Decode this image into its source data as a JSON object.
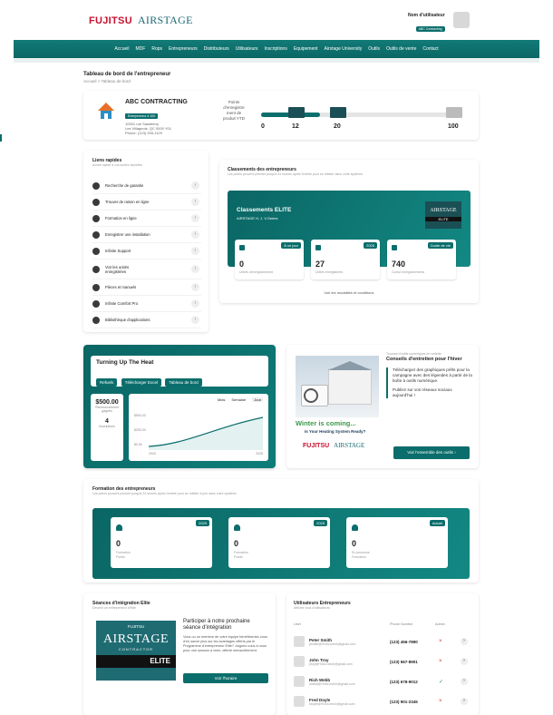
{
  "header": {
    "brand1": "FUJITSU",
    "brand2": "AIRSTAGE",
    "user_label": "Nom d'utilisateur",
    "user_badge": "ABC Contracting"
  },
  "nav": [
    "Accueil",
    "MDF",
    "Rops",
    "Entrepreneurs",
    "Distributeurs",
    "Utilisateurs",
    "Inscriptions",
    "Equipement",
    "Airstage University",
    "Outils",
    "Outils de vente",
    "Contact"
  ],
  "page": {
    "title": "Tableau de bord de l'entrepreneur",
    "breadcrumb": "Accueil > Tableau de bord"
  },
  "company": {
    "name": "ABC CONTRACTING",
    "badge": "Entrepreneur # 100",
    "addr1": "10001 rue Saskberry",
    "addr2": "Les Villageois, QC 0000 Y01",
    "phone": "Phone: (123) 255-1129"
  },
  "points": {
    "label1": "Points",
    "label2": "d'enregistre",
    "label3": "ment de",
    "label4": "produit YTD",
    "ticks": [
      "0",
      "12",
      "20",
      "100"
    ],
    "progress": 0.3
  },
  "quick": {
    "title": "Liens rapides",
    "subtitle": "Accès rapide à vos sorties favorites",
    "items": [
      "Recherche de garantie",
      "Trouver de raison en ligne",
      "Formation en ligne",
      "Enregistrer une installation",
      "Infinite Support",
      "Voir les unités\nenregistrées",
      "Pièces et manuels",
      "Infinite Comfort Pro",
      "Bibliothèque d'applications"
    ]
  },
  "rank": {
    "title": "Classements des entrepreneurs",
    "subtitle": "Les points peuvent prendre jusqu'à 24 heures après l'entrée pour se refléter dans votre système.",
    "elite_title": "Classements ELITE",
    "elite_sub": "AIRSTAGE H, J, V-Series",
    "logo": "AIRSTAGE",
    "logo_tag": "ELITE",
    "tiles": [
      {
        "badge": "À ce jour",
        "value": "0",
        "label": "Unités d'enregistrement"
      },
      {
        "badge": "2025",
        "value": "27",
        "label": "Unités enregistrées"
      },
      {
        "badge": "Guide de vie",
        "value": "740",
        "label": "Cumul enregistrements"
      }
    ],
    "link": "Voir les modalités et conditions"
  },
  "heat": {
    "title": "Turning Up The Heat",
    "b1": "Refuels",
    "b2": "Télécharger Excel",
    "b3": "Tableau de bord",
    "amount": "$500.00",
    "amount_label": "Remboursement gagnés",
    "count": "4",
    "count_label": "Inscriptions",
    "tabs": [
      "Mois",
      "Semaine",
      "Jour"
    ],
    "y": [
      "$500.00",
      "$250.00",
      "$0.00"
    ],
    "x": [
      "2025",
      "2025"
    ]
  },
  "winter": {
    "kicker": "Trousse d'outils numériques en vedette",
    "title": "Conseils d'entretien pour l'hiver",
    "p1": "Téléchargez des graphiques prêts pour la campagne avec des légendes à partir de la boîte à outils numérique.",
    "p2": "Publiez sur vos réseaux sociaux aujourd'hui !",
    "caption": "Winter is coming...",
    "caption2": "Is Your Heating System Ready?",
    "logo1": "FUJITSU",
    "logo2": "AIRSTAGE",
    "btn": "Voir l'ensemble des outils"
  },
  "training": {
    "title": "Formation des entrepreneurs",
    "subtitle": "Les points peuvent prendre jusqu'à 24 heures après l'entrée pour se refléter à jour dans votre système.",
    "tiles": [
      {
        "badge": "2025",
        "value": "0",
        "label": "Formation\nPoints"
      },
      {
        "badge": "2025",
        "value": "0",
        "label": "Formation\nPoints"
      },
      {
        "badge": "Actuel",
        "value": "0",
        "label": "En personne\nFormation"
      }
    ]
  },
  "integration": {
    "title": "Séances d'intégration Elite",
    "subtitle": "Devenir un entrepreneur d'élite",
    "logo_top": "FUJITSU",
    "logo": "AIRSTAGE",
    "logo_sub": "CONTRACTOR",
    "logo_tag": "ELITE",
    "heading": "Participer à notre prochaine séance d'intégration",
    "body": "Vous ou un membre de votre équipe bénéficieriez-vous d'en savoir plus sur les avantages offerts par le Programme d'entrepreneur Elite? Joignez-vous à nous pour une session à venir, offerte mensuellement.",
    "btn": "Voir l'horaire"
  },
  "users": {
    "title": "Utilisateurs Entrepreneurs",
    "subtitle": "Afficher tous d'utilisateurs",
    "cols": [
      "User",
      "Phone Number",
      "Admin"
    ],
    "rows": [
      {
        "name": "Peter Smith",
        "email": "psmith@HVACmech@gmail.com",
        "phone": "(123) 456-7890",
        "admin": "×"
      },
      {
        "name": "John Troy",
        "email": "jtroy@HVACmech@gmail.com",
        "phone": "(123) 567-8901",
        "admin": "×"
      },
      {
        "name": "Rich Webb",
        "email": "rwebb@HVACmech@gmail.com",
        "phone": "(123) 678-9012",
        "admin": "✓"
      },
      {
        "name": "Fred Doyle",
        "email": "fdoyle@HVACmech@gmail.com",
        "phone": "(123) 901-2345",
        "admin": "×"
      }
    ]
  },
  "colors": {
    "teal": "#0b6e6c",
    "red": "#c8102e"
  }
}
